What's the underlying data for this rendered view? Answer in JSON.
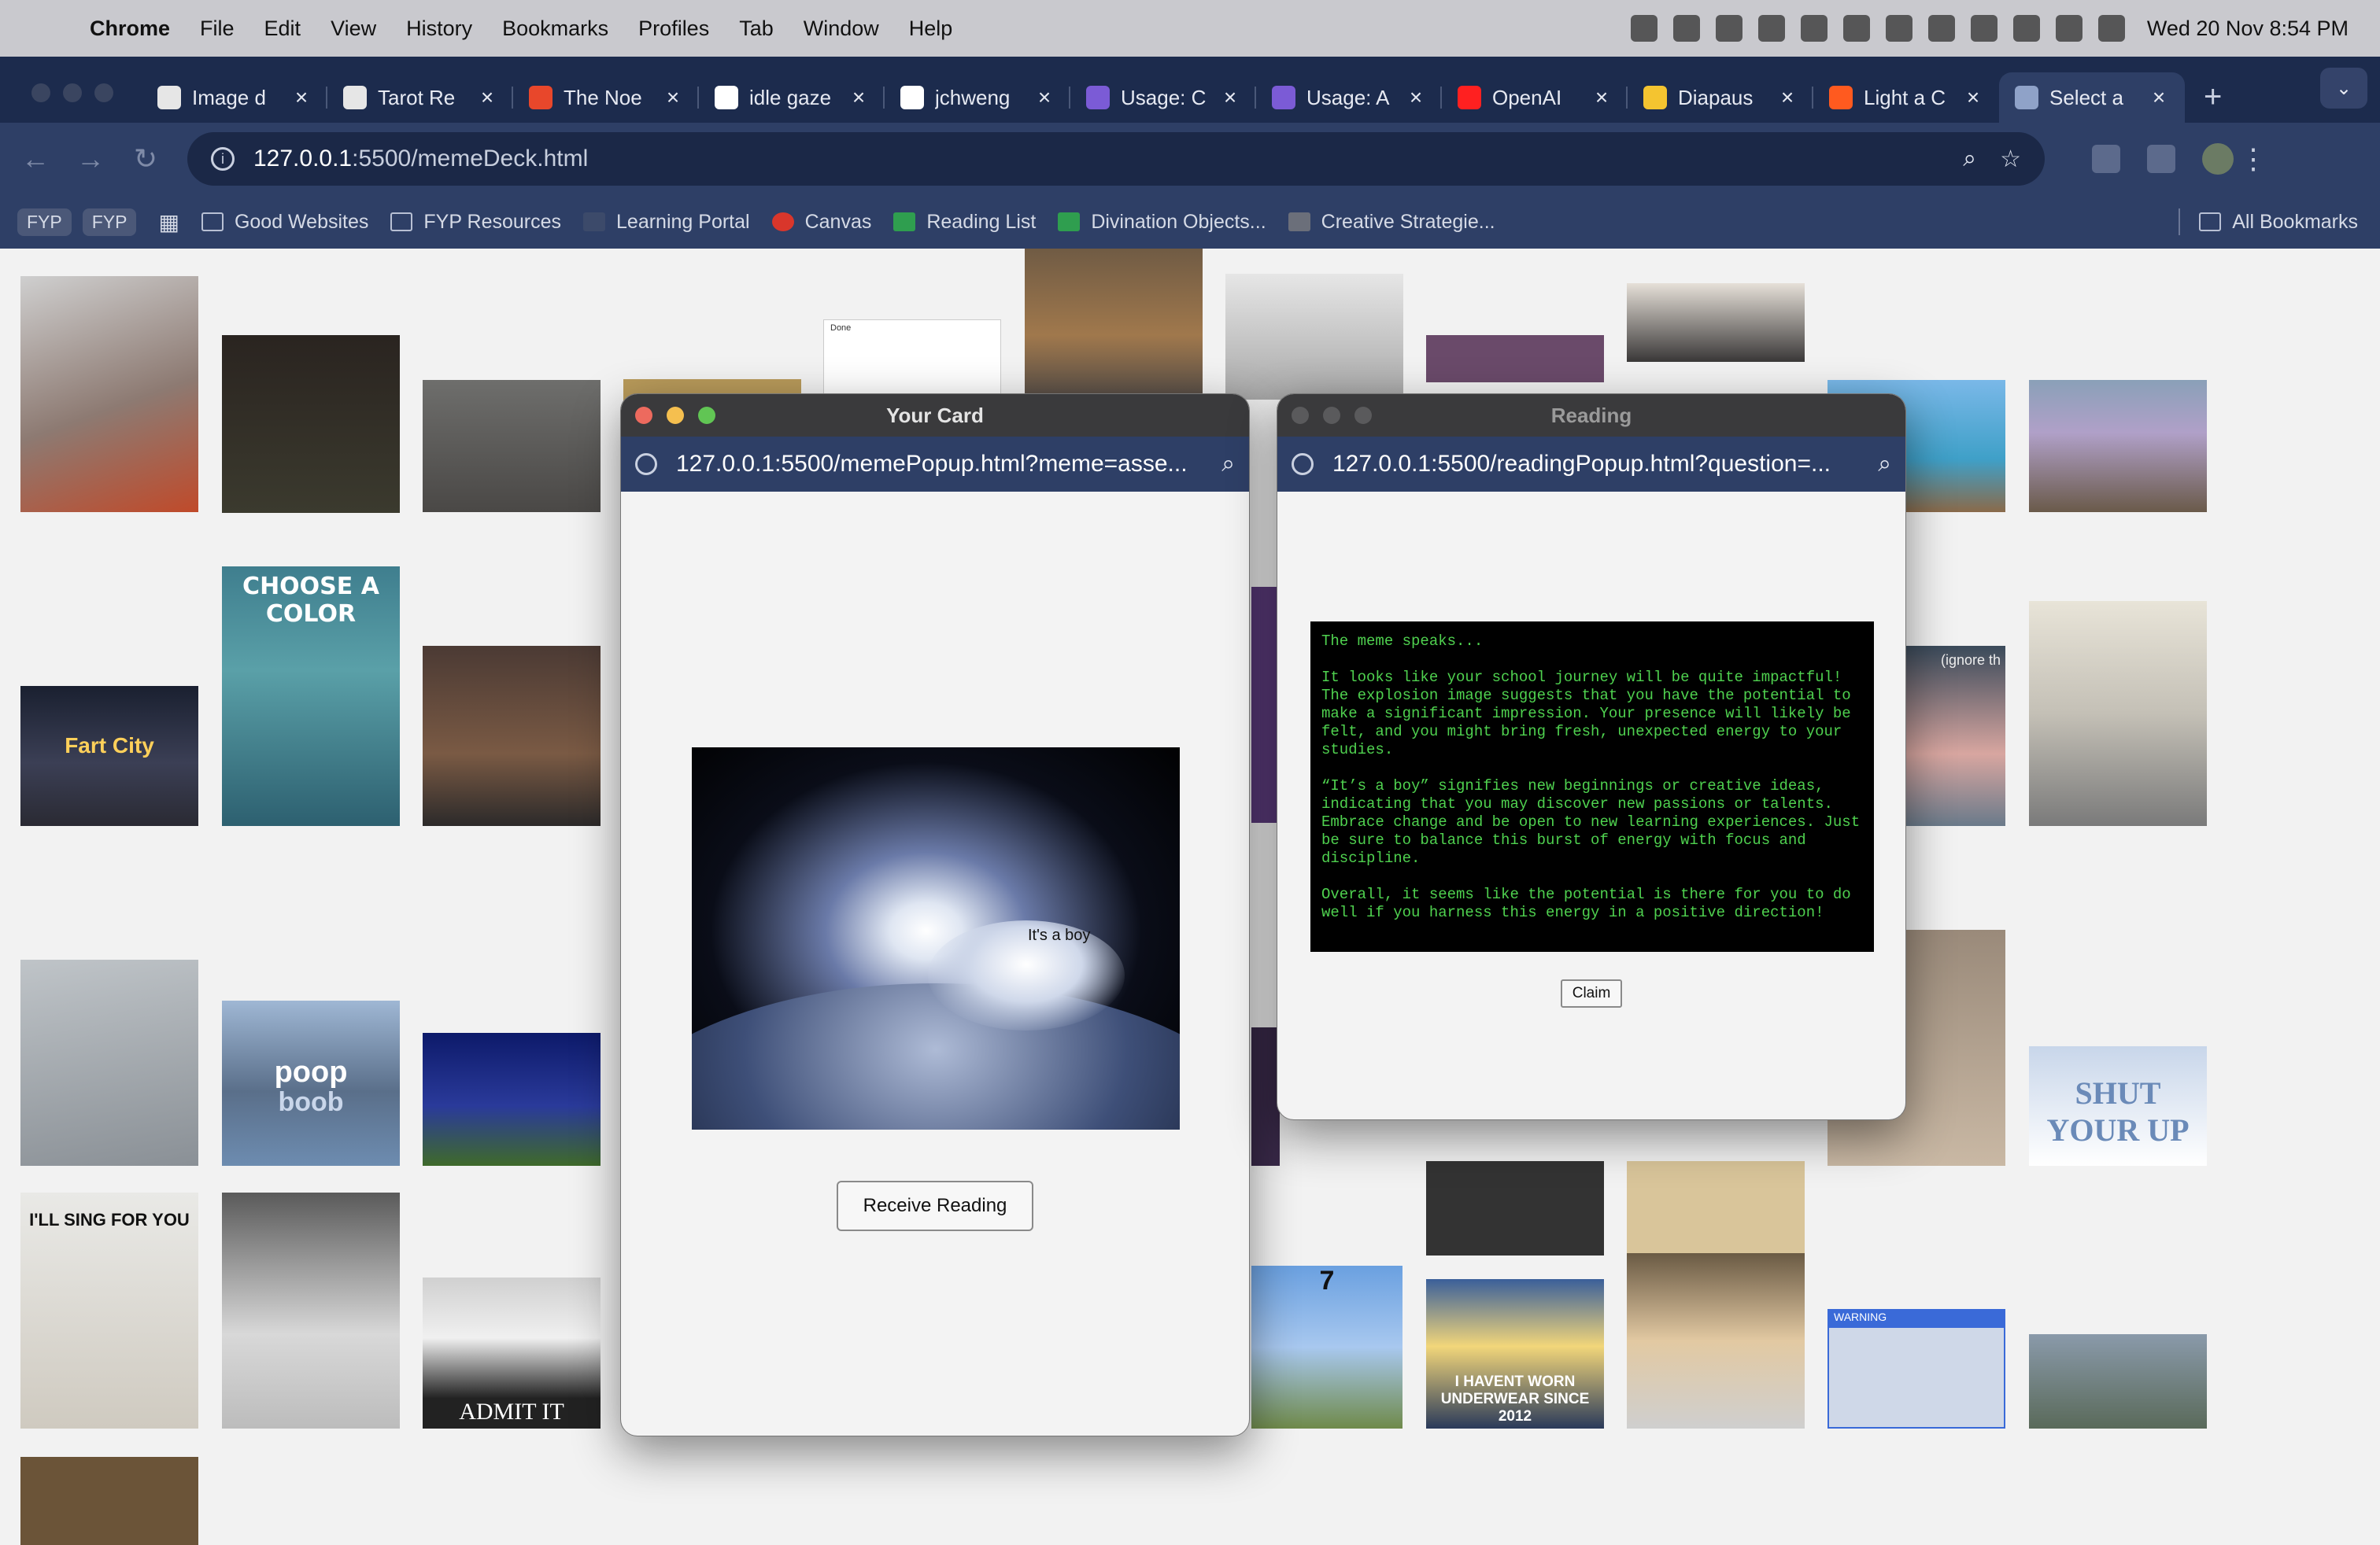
{
  "menubar": {
    "app": "Chrome",
    "items": [
      "File",
      "Edit",
      "View",
      "History",
      "Bookmarks",
      "Profiles",
      "Tab",
      "Window",
      "Help"
    ],
    "clock": "Wed 20 Nov  8:54 PM"
  },
  "tabs": [
    {
      "title": "Image d",
      "color": "#e6e6e6"
    },
    {
      "title": "Tarot Re",
      "color": "#e6e6e6"
    },
    {
      "title": "The Noe",
      "color": "#e8472b"
    },
    {
      "title": "idle gaze",
      "color": "#ffffff"
    },
    {
      "title": "jchweng",
      "color": "#ffffff"
    },
    {
      "title": "Usage: C",
      "color": "#7b5bd6"
    },
    {
      "title": "Usage: A",
      "color": "#7b5bd6"
    },
    {
      "title": "OpenAI",
      "color": "#ff2020"
    },
    {
      "title": "Diapaus",
      "color": "#f4c430"
    },
    {
      "title": "Light a C",
      "color": "#ff5a1f"
    },
    {
      "title": "Select a",
      "color": "#8fa2c8"
    }
  ],
  "omnibox": {
    "url_host": "127.0.0.1",
    "url_path": ":5500/memeDeck.html"
  },
  "bookmarks": {
    "pill1": "FYP",
    "pill2": "FYP",
    "items": [
      "Good Websites",
      "FYP Resources",
      "Learning Portal",
      "Canvas",
      "Reading List",
      "Divination Objects...",
      "Creative Strategie..."
    ],
    "all": "All Bookmarks"
  },
  "memes": {
    "choose_color": "CHOOSE A COLOR",
    "fart_city": "Fart City",
    "poop": "poop",
    "boob": "boob",
    "sing": "I'LL SING FOR YOU",
    "admit": "ADMIT IT",
    "seven": "7",
    "underwear": "I HAVENT WORN UNDERWEAR SINCE 2012",
    "shut": "SHUT YOUR UP",
    "warning": "WARNING",
    "done": "Done",
    "ignore": "(ignore th"
  },
  "card_popup": {
    "title": "Your Card",
    "url": "127.0.0.1:5500/memePopup.html?meme=asse...",
    "caption": "It's a boy",
    "button": "Receive Reading"
  },
  "reading_popup": {
    "title": "Reading",
    "url": "127.0.0.1:5500/readingPopup.html?question=...",
    "text": "The meme speaks...\n\nIt looks like your school journey will be quite impactful! The explosion image suggests that you have the potential to make a significant impression. Your presence will likely be felt, and you might bring fresh, unexpected energy to your studies.\n\n“It’s a boy” signifies new beginnings or creative ideas, indicating that you may discover new passions or talents. Embrace change and be open to new learning experiences. Just be sure to balance this burst of energy with focus and discipline.\n\nOverall, it seems like the potential is there for you to do well if you harness this energy in a positive direction!",
    "button": "Claim"
  }
}
